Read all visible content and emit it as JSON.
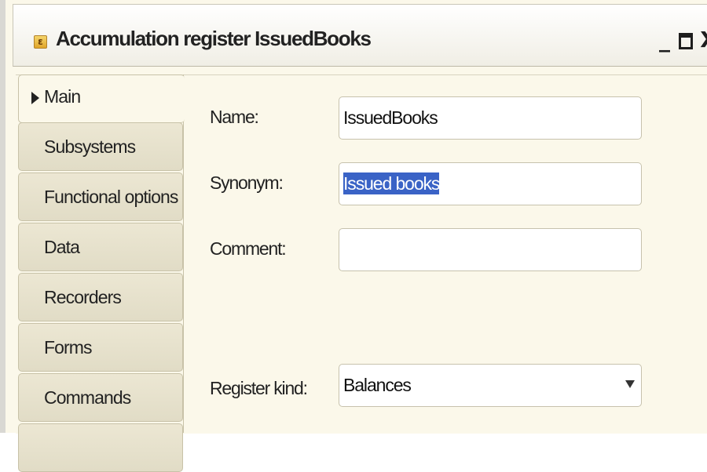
{
  "window": {
    "title": "Accumulation register IssuedBooks",
    "minimize_glyph": "_",
    "close_glyph": "X",
    "icon": "register-icon",
    "icon_glyph": "ε"
  },
  "tabs": [
    {
      "label": "Main",
      "active": true
    },
    {
      "label": "Subsystems"
    },
    {
      "label": "Functional options"
    },
    {
      "label": "Data"
    },
    {
      "label": "Recorders"
    },
    {
      "label": "Forms"
    },
    {
      "label": "Commands"
    }
  ],
  "form": {
    "name_label": "Name:",
    "name_value": "IssuedBooks",
    "synonym_label": "Synonym:",
    "synonym_value": "Issued books",
    "comment_label": "Comment:",
    "comment_value": "",
    "register_kind_label": "Register kind:",
    "register_kind_value": "Balances"
  },
  "colors": {
    "background": "#fbf8ea",
    "tab_inactive": "#e6e1cc",
    "selection": "#3a63c6"
  }
}
